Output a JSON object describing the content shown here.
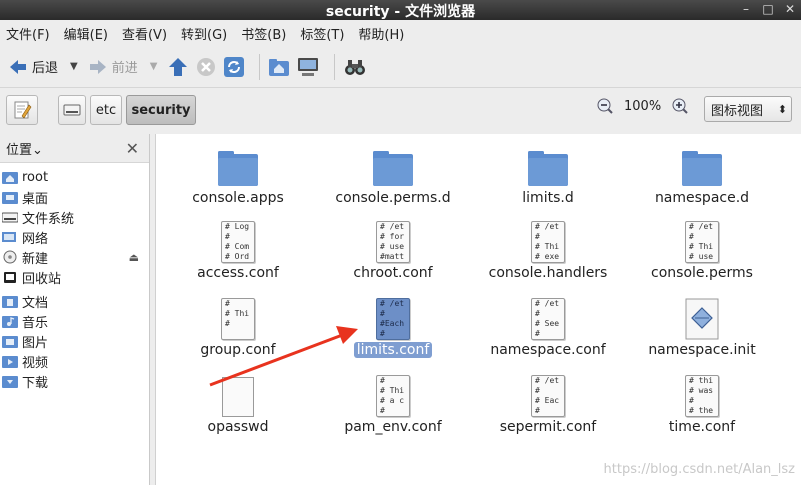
{
  "window": {
    "title": "security - 文件浏览器"
  },
  "menu": [
    "文件(F)",
    "编辑(E)",
    "查看(V)",
    "转到(G)",
    "书签(B)",
    "标签(T)",
    "帮助(H)"
  ],
  "toolbar": {
    "back": "后退",
    "forward": "前进"
  },
  "location": {
    "etc": "etc",
    "current": "security"
  },
  "zoom": {
    "value": "100%"
  },
  "view": {
    "selected": "图标视图"
  },
  "sidebar": {
    "header": "位置",
    "items": [
      "root",
      "桌面",
      "文件系统",
      "网络",
      "新建",
      "回收站"
    ],
    "bookmarks": [
      "文档",
      "音乐",
      "图片",
      "视频",
      "下载"
    ]
  },
  "files": [
    {
      "name": "console.apps",
      "kind": "folder"
    },
    {
      "name": "console.perms.d",
      "kind": "folder"
    },
    {
      "name": "limits.d",
      "kind": "folder"
    },
    {
      "name": "namespace.d",
      "kind": "folder"
    },
    {
      "name": "access.conf",
      "kind": "text",
      "preview": "# Log\n#\n# Com\n# Ord"
    },
    {
      "name": "chroot.conf",
      "kind": "text",
      "preview": "# /et\n# for\n# use\n#matt"
    },
    {
      "name": "console.handlers",
      "kind": "text",
      "preview": "# /et\n#\n# Thi\n# exe"
    },
    {
      "name": "console.perms",
      "kind": "text",
      "preview": "# /et\n#\n# Thi\n# use"
    },
    {
      "name": "group.conf",
      "kind": "text",
      "preview": "#\n# Thi\n#"
    },
    {
      "name": "limits.conf",
      "kind": "text",
      "preview": "# /et\n#\n#Each\n#",
      "selected": true
    },
    {
      "name": "namespace.conf",
      "kind": "text",
      "preview": "# /et\n#\n# See\n#"
    },
    {
      "name": "namespace.init",
      "kind": "script"
    },
    {
      "name": "opasswd",
      "kind": "blank"
    },
    {
      "name": "pam_env.conf",
      "kind": "text",
      "preview": "#\n# Thi\n# a c\n#"
    },
    {
      "name": "sepermit.conf",
      "kind": "text",
      "preview": "# /et\n#\n# Eac\n#"
    },
    {
      "name": "time.conf",
      "kind": "text",
      "preview": "# thi\n# was\n#\n# the"
    }
  ],
  "watermark": "https://blog.csdn.net/Alan_lsz",
  "colors": {
    "accent": "#7f9ed1",
    "folder": "#5b8ccf",
    "arrow": "#e8331e"
  }
}
